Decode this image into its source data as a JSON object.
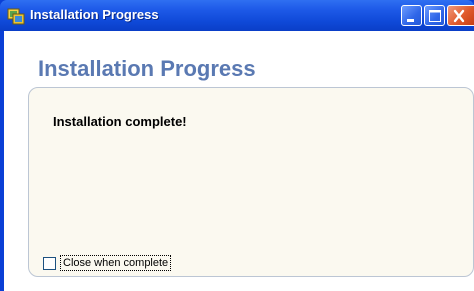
{
  "window": {
    "title": "Installation Progress",
    "icon": "installer-icon"
  },
  "titlebar_buttons": {
    "minimize": "minimize-icon",
    "maximize": "maximize-icon",
    "close": "close-icon"
  },
  "main": {
    "heading": "Installation Progress",
    "status_message": "Installation complete!",
    "close_when_complete": {
      "label": "Close when complete",
      "checked": false
    }
  },
  "colors": {
    "titlebar": "#0f49d8",
    "heading": "#5a79b2",
    "panel_background": "#fbf9f0",
    "close_button": "#e05a2c"
  }
}
